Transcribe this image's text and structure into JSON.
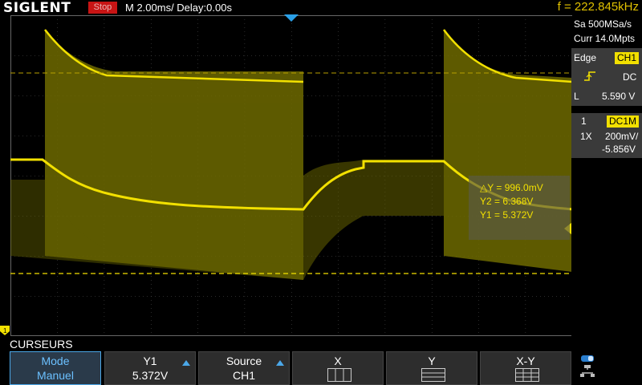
{
  "header": {
    "brand": "SIGLENT",
    "run_state": "Stop",
    "timebase": "M 2.00ms/ Delay:0.00s",
    "frequency": "f = 222.845kHz"
  },
  "acquisition": {
    "sample_rate": "Sa 500MSa/s",
    "memory": "Curr 14.0Mpts"
  },
  "trigger": {
    "type": "Edge",
    "source": "CH1",
    "coupling": "DC",
    "level_label": "L",
    "level": "5.590 V"
  },
  "channel": {
    "number": "1",
    "coupling_badge": "DC1M",
    "probe": "1X",
    "scale": "200mV/",
    "offset": "-5.856V"
  },
  "cursors": {
    "delta_y": "△Y = 996.0mV",
    "y2": "Y2 = 6.368V",
    "y1": "Y1 = 5.372V"
  },
  "menu": {
    "title": "CURSEURS",
    "softkeys": [
      {
        "line1": "Mode",
        "line2": "Manuel"
      },
      {
        "line1": "Y1",
        "line2": "5.372V"
      },
      {
        "line1": "Source",
        "line2": "CH1"
      },
      {
        "line1": "X",
        "line2": ""
      },
      {
        "line1": "Y",
        "line2": ""
      },
      {
        "line1": "X-Y",
        "line2": ""
      }
    ]
  },
  "colors": {
    "trace": "#f2e000",
    "accent": "#4ba7e8",
    "stop": "#c81414"
  },
  "icons": {
    "trigger_edge": "rising-edge-icon",
    "trigger_marker": "trigger-position-icon",
    "level_marker": "trigger-level-icon",
    "ground_marker": "channel1-ground-icon",
    "network": "network-icon"
  }
}
